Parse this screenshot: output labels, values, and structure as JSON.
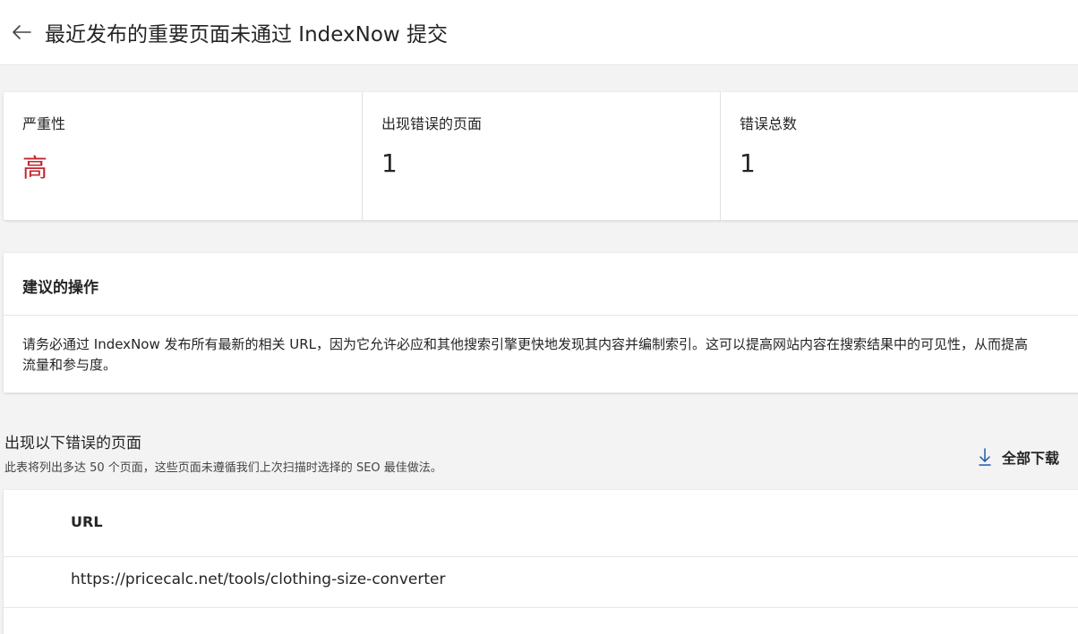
{
  "header": {
    "title": "最近发布的重要页面未通过 IndexNow 提交"
  },
  "metrics": [
    {
      "label": "严重性",
      "value": "高",
      "color": "#c4262e"
    },
    {
      "label": "出现错误的页面",
      "value": "1",
      "color": "#242424"
    },
    {
      "label": "错误总数",
      "value": "1",
      "color": "#242424"
    }
  ],
  "advice": {
    "title": "建议的操作",
    "body": "请务必通过 IndexNow 发布所有最新的相关 URL，因为它允许必应和其他搜索引擎更快地发现其内容并编制索引。这可以提高网站内容在搜索结果中的可见性，从而提高流量和参与度。"
  },
  "pages_section": {
    "title": "出现以下错误的页面",
    "subtitle": "此表将列出多达 50 个页面，这些页面未遵循我们上次扫描时选择的 SEO 最佳做法。",
    "download_label": "全部下载"
  },
  "table": {
    "columns": [
      "URL"
    ],
    "rows": [
      [
        "https://pricecalc.net/tools/clothing-size-converter"
      ]
    ]
  },
  "colors": {
    "severity_high": "#c4262e",
    "download_icon": "#1a5ea8"
  }
}
